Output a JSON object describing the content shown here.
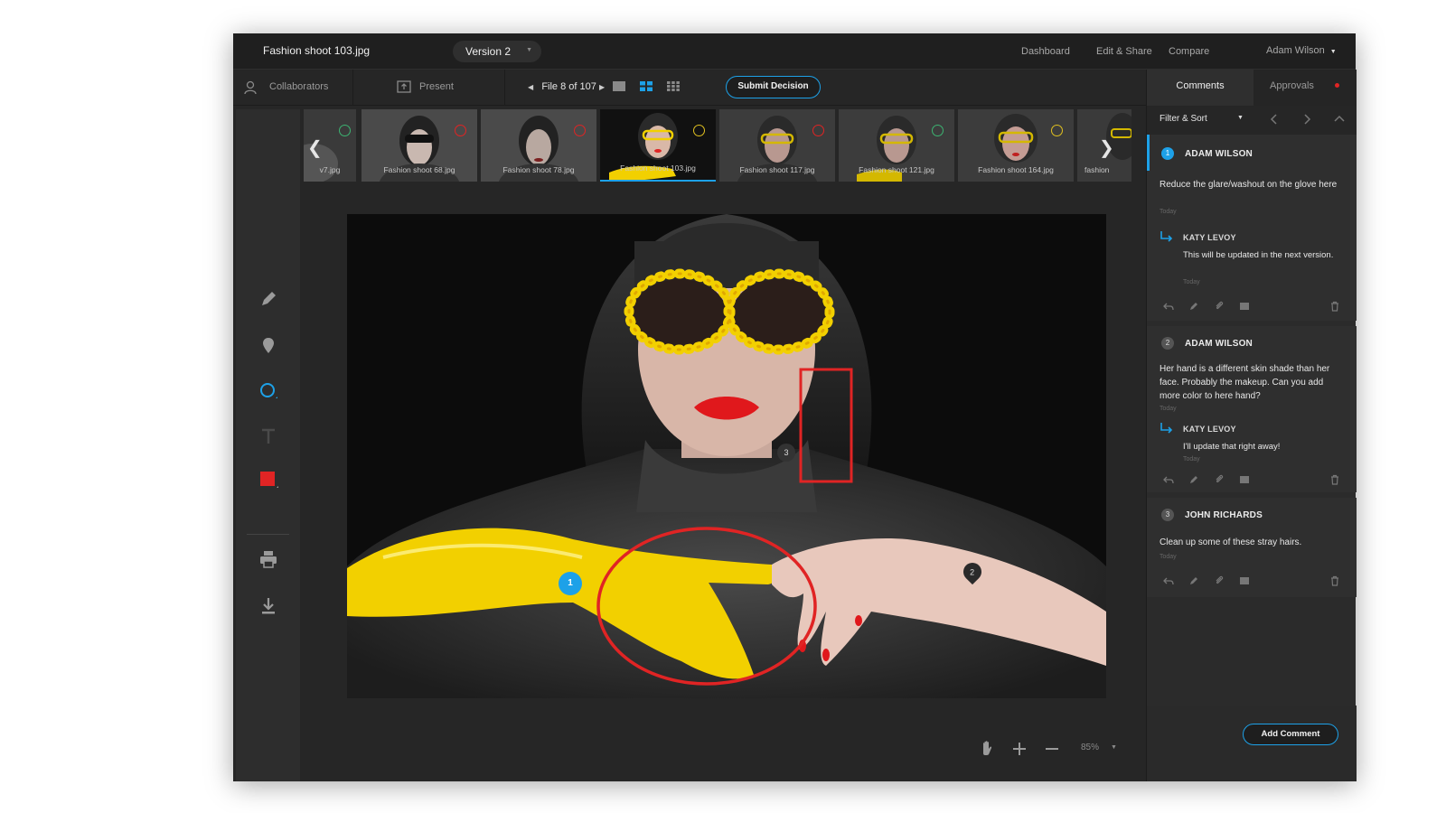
{
  "app": {
    "file_title": "Fashion shoot 103.jpg",
    "version": "Version 2",
    "nav": [
      "Dashboard",
      "Edit & Share",
      "Compare"
    ],
    "user": "Adam Wilson"
  },
  "toolbar": {
    "collaborators": "Collaborators",
    "present": "Present",
    "file_position": "File 8 of 107",
    "submit_label": "Submit Decision"
  },
  "filmstrip": [
    {
      "label": "v7.jpg",
      "status": "approved"
    },
    {
      "label": "Fashion shoot 68.jpg",
      "status": "rejected"
    },
    {
      "label": "Fashion shoot 78.jpg",
      "status": "rejected"
    },
    {
      "label": "Fashion shoot 103.jpg",
      "status": "pending",
      "selected": true
    },
    {
      "label": "Fashion shoot 117.jpg",
      "status": "rejected"
    },
    {
      "label": "Fashion shoot 121.jpg",
      "status": "approved"
    },
    {
      "label": "Fashion shoot 164.jpg",
      "status": "pending"
    },
    {
      "label": "fashion",
      "status": ""
    }
  ],
  "panel": {
    "tab_comments": "Comments",
    "tab_approvals": "Approvals",
    "filter_label": "Filter & Sort",
    "add_comment": "Add Comment"
  },
  "comments": [
    {
      "num": "1",
      "author": "ADAM WILSON",
      "text": "Reduce the glare/washout on the glove here",
      "time": "Today",
      "reply": {
        "author": "KATY LEVOY",
        "text": "This will be updated in the next version.",
        "time": "Today"
      }
    },
    {
      "num": "2",
      "author": "ADAM WILSON",
      "text": "Her hand is a different skin shade than her face. Probably the makeup. Can you add more color to here hand?",
      "time": "Today",
      "reply": {
        "author": "KATY LEVOY",
        "text": "I'll update that right away!",
        "time": "Today"
      }
    },
    {
      "num": "3",
      "author": "JOHN RICHARDS",
      "text": "Clean up some of these stray hairs.",
      "time": "Today"
    }
  ],
  "markers": [
    "1",
    "2",
    "3"
  ],
  "zoom": "85%",
  "colors": {
    "accent": "#1da1e8",
    "annotation": "#e02424",
    "approved": "#3cb371",
    "pending": "#e0c020"
  }
}
